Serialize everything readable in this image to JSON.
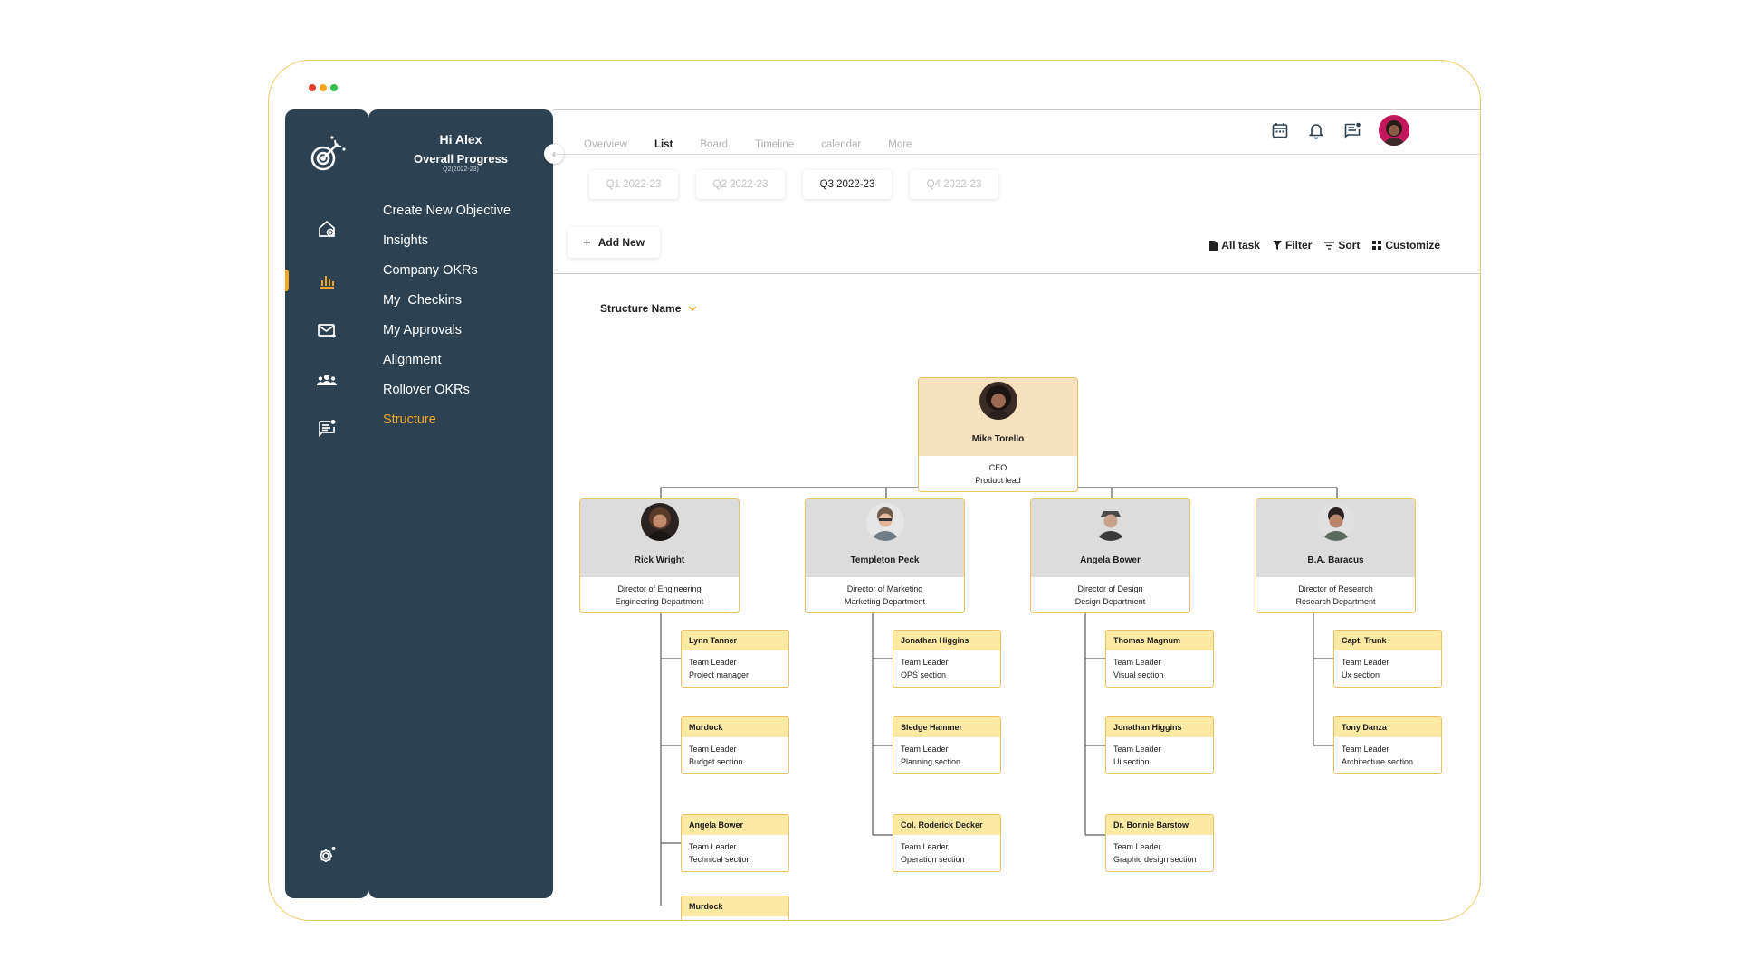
{
  "colors": {
    "accent": "#f5a623",
    "sidebar": "#2c4252",
    "window_border": "#f0c860"
  },
  "window": {
    "traffic_lights": [
      "#e33a2f",
      "#f5a623",
      "#2fbf4f"
    ]
  },
  "rail": {
    "icons": [
      "target-logo-icon",
      "home-icon",
      "chart-icon",
      "mail-icon",
      "team-icon",
      "chat-icon",
      "settings-icon"
    ]
  },
  "menu": {
    "greeting": "Hi Alex",
    "progress_label": "Overall Progress",
    "period": "Q2(2022-23)",
    "items": [
      "Create New Objective",
      "Insights",
      "Company OKRs",
      "My  Checkins",
      "My Approvals",
      "Alignment",
      "Rollover OKRs",
      "Structure"
    ],
    "active_item": "Structure"
  },
  "tabs": [
    "Overview",
    "List",
    "Board",
    "Timeline",
    "calendar",
    "More"
  ],
  "active_tab": "List",
  "quarters": [
    "Q1 2022-23",
    "Q2 2022-23",
    "Q3 2022-23",
    "Q4 2022-23"
  ],
  "active_quarter": "Q3 2022-23",
  "add_new_label": "Add New",
  "actions": {
    "all_task": "All task",
    "filter": "Filter",
    "sort": "Sort",
    "customize": "Customize"
  },
  "structure_label": "Structure Name",
  "org": {
    "ceo": {
      "name": "Mike Torello",
      "role1": "CEO",
      "role2": "Product lead"
    },
    "directors": [
      {
        "name": "Rick Wright",
        "role1": "Director of Engineering",
        "role2": "Engineering Department"
      },
      {
        "name": "Templeton Peck",
        "role1": "Director of Marketing",
        "role2": "Marketing Department"
      },
      {
        "name": "Angela Bower",
        "role1": "Director of Design",
        "role2": "Design Department"
      },
      {
        "name": "B.A. Baracus",
        "role1": "Director of Research",
        "role2": "Research Department"
      }
    ],
    "teams": [
      [
        {
          "name": "Lynn Tanner",
          "role1": "Team Leader",
          "role2": "Project manager"
        },
        {
          "name": "Murdock",
          "role1": "Team Leader",
          "role2": "Budget section"
        },
        {
          "name": "Angela Bower",
          "role1": "Team Leader",
          "role2": "Technical section"
        },
        {
          "name": "Murdock",
          "role1": "",
          "role2": ""
        }
      ],
      [
        {
          "name": "Jonathan Higgins",
          "role1": "Team Leader",
          "role2": "OPS section"
        },
        {
          "name": "Sledge Hammer",
          "role1": "Team Leader",
          "role2": "Planning section"
        },
        {
          "name": "Col. Roderick Decker",
          "role1": "Team Leader",
          "role2": "Operation section"
        }
      ],
      [
        {
          "name": "Thomas Magnum",
          "role1": "Team Leader",
          "role2": "Visual section"
        },
        {
          "name": "Jonathan Higgins",
          "role1": "Team Leader",
          "role2": "Ui section"
        },
        {
          "name": "Dr. Bonnie Barstow",
          "role1": "Team Leader",
          "role2": "Graphic design section"
        }
      ],
      [
        {
          "name": "Capt. Trunk",
          "role1": "Team Leader",
          "role2": "Ux section"
        },
        {
          "name": "Tony Danza",
          "role1": "Team Leader",
          "role2": "Architecture section"
        }
      ]
    ]
  }
}
